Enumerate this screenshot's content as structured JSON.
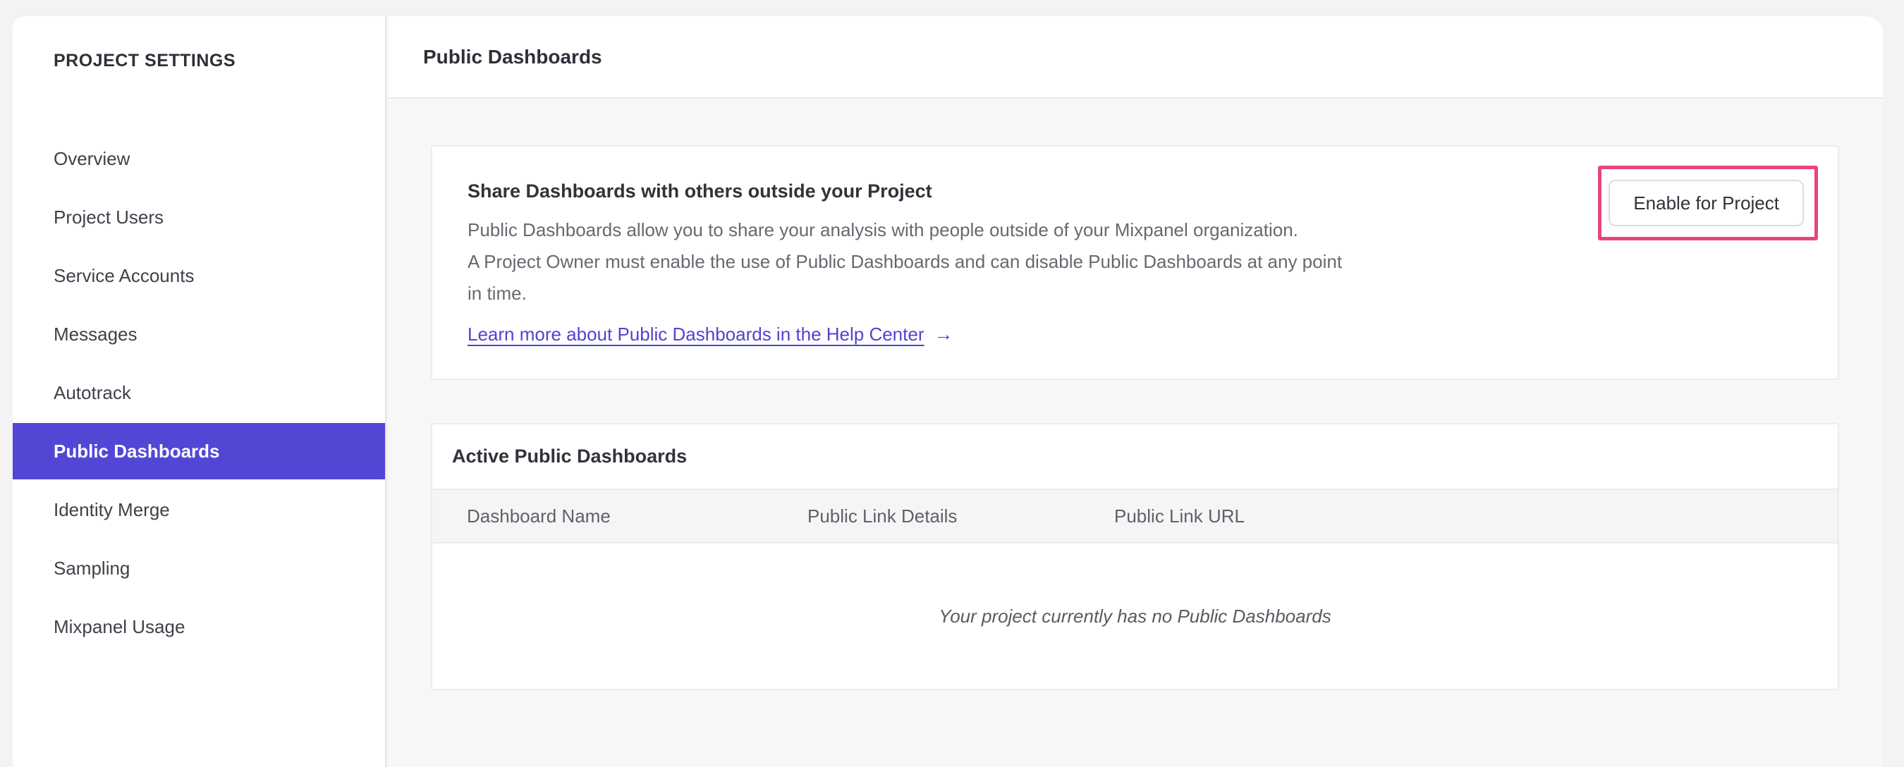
{
  "sidebar": {
    "title": "PROJECT SETTINGS",
    "items": [
      {
        "label": "Overview",
        "selected": false
      },
      {
        "label": "Project Users",
        "selected": false
      },
      {
        "label": "Service Accounts",
        "selected": false
      },
      {
        "label": "Messages",
        "selected": false
      },
      {
        "label": "Autotrack",
        "selected": false
      },
      {
        "label": "Public Dashboards",
        "selected": true
      },
      {
        "label": "Identity Merge",
        "selected": false
      },
      {
        "label": "Sampling",
        "selected": false
      },
      {
        "label": "Mixpanel Usage",
        "selected": false
      }
    ]
  },
  "header": {
    "title": "Public Dashboards"
  },
  "share_card": {
    "title": "Share Dashboards with others outside your Project",
    "body_lines": [
      "Public Dashboards allow you to share your analysis with people outside of your Mixpanel organization.",
      "A Project Owner must enable the use of Public Dashboards and can disable Public Dashboards at any point",
      "in time."
    ],
    "link_label": "Learn more about Public Dashboards in the Help Center",
    "link_arrow": "→",
    "button_label": "Enable for Project"
  },
  "active_card": {
    "title": "Active Public Dashboards",
    "columns": [
      "Dashboard Name",
      "Public Link Details",
      "Public Link URL"
    ],
    "empty_message": "Your project currently has no Public Dashboards"
  },
  "colors": {
    "accent": "#5247d5",
    "link": "#4f44d2",
    "highlight": "#e8457d"
  }
}
